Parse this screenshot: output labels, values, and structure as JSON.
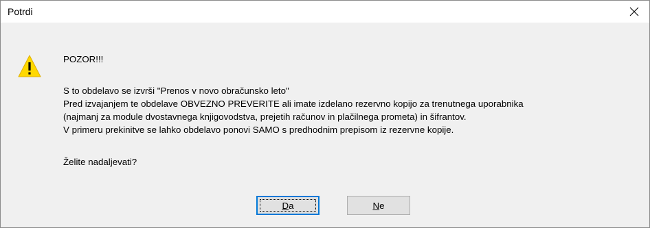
{
  "dialog": {
    "title": "Potrdi",
    "warning_heading": "POZOR!!!",
    "message_lines": [
      "S to obdelavo se izvrši \"Prenos v novo obračunsko leto\"",
      "Pred izvajanjem te obdelave OBVEZNO PREVERITE ali imate izdelano rezervno kopijo za trenutnega uporabnika",
      "(najmanj za module dvostavnega knjigovodstva, prejetih računov in plačilnega prometa) in šifrantov.",
      "V primeru prekinitve se lahko obdelavo ponovi SAMO s predhodnim prepisom iz rezervne kopije."
    ],
    "question": "Želite nadaljevati?",
    "buttons": {
      "yes": {
        "accel": "D",
        "rest": "a"
      },
      "no": {
        "accel": "N",
        "rest": "e"
      }
    },
    "icons": {
      "warning": "warning-triangle-icon",
      "close": "close-icon"
    },
    "colors": {
      "warning_yellow": "#ffd800",
      "default_button_border": "#0078d7",
      "dialog_background": "#f0f0f0"
    }
  }
}
